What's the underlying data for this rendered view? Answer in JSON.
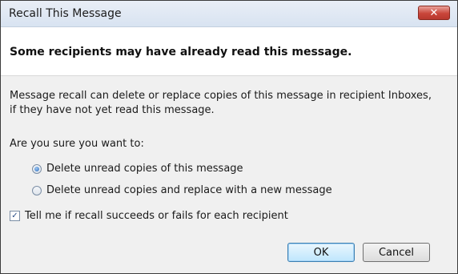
{
  "window": {
    "title": "Recall This Message",
    "close_icon": "close-icon"
  },
  "heading": "Some recipients may have already read this message.",
  "description": {
    "line1": "Message recall can delete or replace copies of this message in recipient Inboxes,",
    "line2": "if they have not yet read this message."
  },
  "question": "Are you sure you want to:",
  "options": [
    {
      "label": "Delete unread copies of this message",
      "selected": true
    },
    {
      "label": "Delete unread copies and replace with a new message",
      "selected": false
    }
  ],
  "checkbox": {
    "label": "Tell me if recall succeeds or fails for each recipient",
    "checked": true
  },
  "buttons": {
    "ok": "OK",
    "cancel": "Cancel"
  }
}
